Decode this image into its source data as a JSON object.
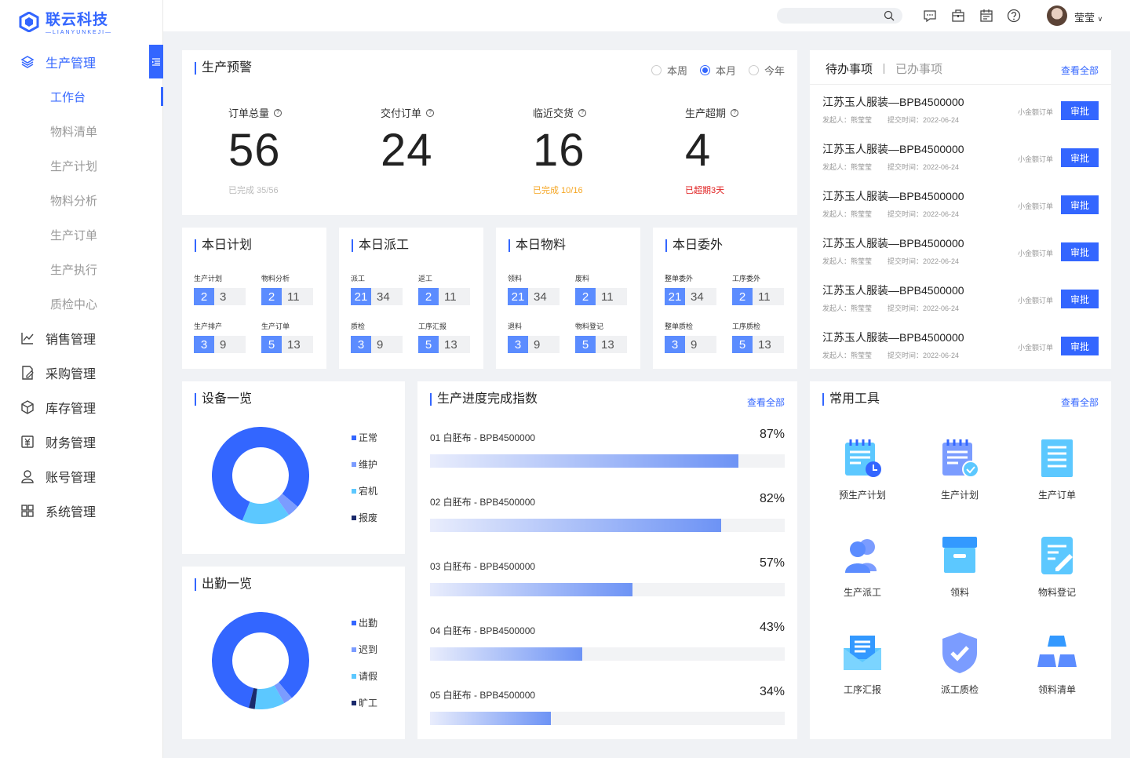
{
  "brand": {
    "name": "联云科技",
    "sub": "—LIANYUNKEJI—",
    "color": "#3366ff"
  },
  "sidebar": {
    "groups": [
      {
        "label": "生产管理",
        "icon": "layers-icon",
        "active": true,
        "items": [
          {
            "label": "工作台",
            "active": true
          },
          {
            "label": "物料清单"
          },
          {
            "label": "生产计划"
          },
          {
            "label": "物料分析"
          },
          {
            "label": "生产订单"
          },
          {
            "label": "生产执行"
          },
          {
            "label": "质检中心"
          }
        ]
      },
      {
        "label": "销售管理",
        "icon": "line-chart-icon"
      },
      {
        "label": "采购管理",
        "icon": "purchase-doc-icon"
      },
      {
        "label": "库存管理",
        "icon": "box-icon"
      },
      {
        "label": "财务管理",
        "icon": "finance-icon"
      },
      {
        "label": "账号管理",
        "icon": "user-icon"
      },
      {
        "label": "系统管理",
        "icon": "grid-icon"
      }
    ]
  },
  "topbar": {
    "search_placeholder": "",
    "user": "莹莹",
    "icons": [
      "message-icon",
      "briefcase-icon",
      "calendar-icon",
      "help-icon"
    ]
  },
  "warning": {
    "title": "生产预警",
    "range_options": [
      "本周",
      "本月",
      "今年"
    ],
    "range_selected": "本月",
    "stats": [
      {
        "label": "订单总量",
        "value": "56",
        "sub": "已完成 35/56",
        "sub_color": "#bbbbbb"
      },
      {
        "label": "交付订单",
        "value": "24",
        "sub": "",
        "sub_color": "#bbbbbb"
      },
      {
        "label": "临近交货",
        "value": "16",
        "sub": "已完成 10/16",
        "sub_color": "#f5a623"
      },
      {
        "label": "生产超期",
        "value": "4",
        "sub": "已超期3天",
        "sub_color": "#e02020"
      }
    ]
  },
  "daily": [
    {
      "title": "本日计划",
      "cells": [
        {
          "label": "生产计划",
          "a": "2",
          "b": "3"
        },
        {
          "label": "物料分析",
          "a": "2",
          "b": "11"
        },
        {
          "label": "生产排产",
          "a": "3",
          "b": "9"
        },
        {
          "label": "生产订单",
          "a": "5",
          "b": "13"
        }
      ]
    },
    {
      "title": "本日派工",
      "cells": [
        {
          "label": "派工",
          "a": "21",
          "b": "34"
        },
        {
          "label": "返工",
          "a": "2",
          "b": "11"
        },
        {
          "label": "质检",
          "a": "3",
          "b": "9"
        },
        {
          "label": "工序汇报",
          "a": "5",
          "b": "13"
        }
      ]
    },
    {
      "title": "本日物料",
      "cells": [
        {
          "label": "领料",
          "a": "21",
          "b": "34"
        },
        {
          "label": "废料",
          "a": "2",
          "b": "11"
        },
        {
          "label": "退料",
          "a": "3",
          "b": "9"
        },
        {
          "label": "物料登记",
          "a": "5",
          "b": "13"
        }
      ]
    },
    {
      "title": "本日委外",
      "cells": [
        {
          "label": "整单委外",
          "a": "21",
          "b": "34"
        },
        {
          "label": "工序委外",
          "a": "2",
          "b": "11"
        },
        {
          "label": "整单质检",
          "a": "3",
          "b": "9"
        },
        {
          "label": "工序质检",
          "a": "5",
          "b": "13"
        }
      ]
    }
  ],
  "todo": {
    "tabs": [
      "待办事项",
      "已办事项"
    ],
    "active_tab": "待办事项",
    "more": "查看全部",
    "items": [
      {
        "title": "江苏玉人服装—BPB4500000",
        "initiator": "发起人：熊莹莹",
        "time": "提交时间：2022-06-24",
        "tag": "小金额订单",
        "action": "审批"
      },
      {
        "title": "江苏玉人服装—BPB4500000",
        "initiator": "发起人：熊莹莹",
        "time": "提交时间：2022-06-24",
        "tag": "小金额订单",
        "action": "审批"
      },
      {
        "title": "江苏玉人服装—BPB4500000",
        "initiator": "发起人：熊莹莹",
        "time": "提交时间：2022-06-24",
        "tag": "小金额订单",
        "action": "审批"
      },
      {
        "title": "江苏玉人服装—BPB4500000",
        "initiator": "发起人：熊莹莹",
        "time": "提交时间：2022-06-24",
        "tag": "小金额订单",
        "action": "审批"
      },
      {
        "title": "江苏玉人服装—BPB4500000",
        "initiator": "发起人：熊莹莹",
        "time": "提交时间：2022-06-24",
        "tag": "小金额订单",
        "action": "审批"
      },
      {
        "title": "江苏玉人服装—BPB4500000",
        "initiator": "发起人：熊莹莹",
        "time": "提交时间：2022-06-24",
        "tag": "小金额订单",
        "action": "审批"
      }
    ]
  },
  "equipment": {
    "title": "设备一览"
  },
  "attendance": {
    "title": "出勤一览"
  },
  "chart_data": [
    {
      "type": "pie",
      "title": "设备一览",
      "labels": [
        "正常",
        "维护",
        "宕机",
        "报废"
      ],
      "values": [
        80,
        4,
        16,
        0
      ],
      "colors": [
        "#3366ff",
        "#7b9cff",
        "#5cc8ff",
        "#1a2a6c"
      ]
    },
    {
      "type": "pie",
      "title": "出勤一览",
      "labels": [
        "出勤",
        "迟到",
        "请假",
        "旷工"
      ],
      "values": [
        85,
        3,
        10,
        2
      ],
      "colors": [
        "#3366ff",
        "#7b9cff",
        "#5cc8ff",
        "#1a2a6c"
      ]
    }
  ],
  "progress": {
    "title": "生产进度完成指数",
    "more": "查看全部",
    "items": [
      {
        "label": "01 白胚布 - BPB4500000",
        "value": 87,
        "text": "87%"
      },
      {
        "label": "02 白胚布 - BPB4500000",
        "value": 82,
        "text": "82%"
      },
      {
        "label": "03 白胚布 - BPB4500000",
        "value": 57,
        "text": "57%"
      },
      {
        "label": "04 白胚布 - BPB4500000",
        "value": 43,
        "text": "43%"
      },
      {
        "label": "05 白胚布 - BPB4500000",
        "value": 34,
        "text": "34%"
      }
    ]
  },
  "tools": {
    "title": "常用工具",
    "more": "查看全部",
    "items": [
      {
        "label": "预生产计划",
        "icon": "pre-plan-icon"
      },
      {
        "label": "生产计划",
        "icon": "plan-icon"
      },
      {
        "label": "生产订单",
        "icon": "order-icon"
      },
      {
        "label": "生产派工",
        "icon": "dispatch-icon"
      },
      {
        "label": "领料",
        "icon": "material-box-icon"
      },
      {
        "label": "物料登记",
        "icon": "material-register-icon"
      },
      {
        "label": "工序汇报",
        "icon": "process-report-icon"
      },
      {
        "label": "派工质检",
        "icon": "quality-check-icon"
      },
      {
        "label": "领料清单",
        "icon": "material-list-icon"
      }
    ]
  }
}
